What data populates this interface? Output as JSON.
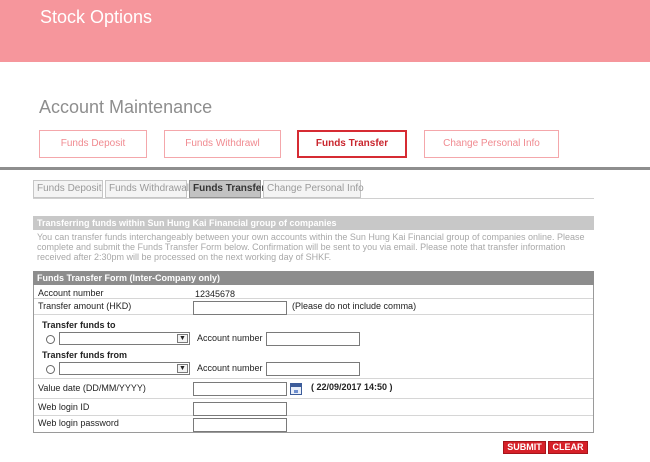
{
  "hero": {
    "title": "Stock Options"
  },
  "account_maintenance": {
    "title": "Account Maintenance",
    "tabs": [
      {
        "label": "Funds Deposit"
      },
      {
        "label": "Funds Withdrawl"
      },
      {
        "label": "Funds Transfer",
        "active": true
      },
      {
        "label": "Change Personal Info"
      }
    ]
  },
  "subtabs": [
    {
      "label": "Funds Deposit"
    },
    {
      "label": "Funds Withdrawal"
    },
    {
      "label": "Funds Transfer",
      "active": true
    },
    {
      "label": "Change Personal Info"
    }
  ],
  "intro": {
    "heading": "Transferring funds within Sun Hung Kai Financial group of companies",
    "text": "You can transfer funds interchangeably between your own accounts within the Sun Hung Kai Financial group of companies online. Please complete and submit the Funds Transfer Form below. Confirmation will be sent to you via email. Please note that transfer information received after 2:30pm will be processed on the next working day of SHKF."
  },
  "form": {
    "heading": "Funds Transfer Form (Inter-Company only)",
    "account_number_label": "Account number",
    "account_number_value": "12345678",
    "transfer_amount_label": "Transfer amount (HKD)",
    "transfer_amount_value": "",
    "transfer_amount_hint": "(Please do not include comma)",
    "transfer_to_label": "Transfer funds to",
    "transfer_to_selected": "",
    "transfer_to_account_label": "Account number",
    "transfer_to_account_value": "",
    "transfer_from_label": "Transfer funds from",
    "transfer_from_selected": "",
    "transfer_from_account_label": "Account number",
    "transfer_from_account_value": "",
    "value_date_label": "Value date (DD/MM/YYYY)",
    "value_date_value": "",
    "value_date_current": "( 22/09/2017 14:50 )",
    "web_login_id_label": "Web login ID",
    "web_login_password_label": "Web login password"
  },
  "buttons": {
    "submit": "SUBMIT",
    "clear": "CLEAR"
  },
  "icons": {
    "calendar": "calendar-icon",
    "dropdown": "chevron-down-icon"
  },
  "colors": {
    "brand_pink": "#f6969c",
    "accent_red": "#d62028"
  }
}
